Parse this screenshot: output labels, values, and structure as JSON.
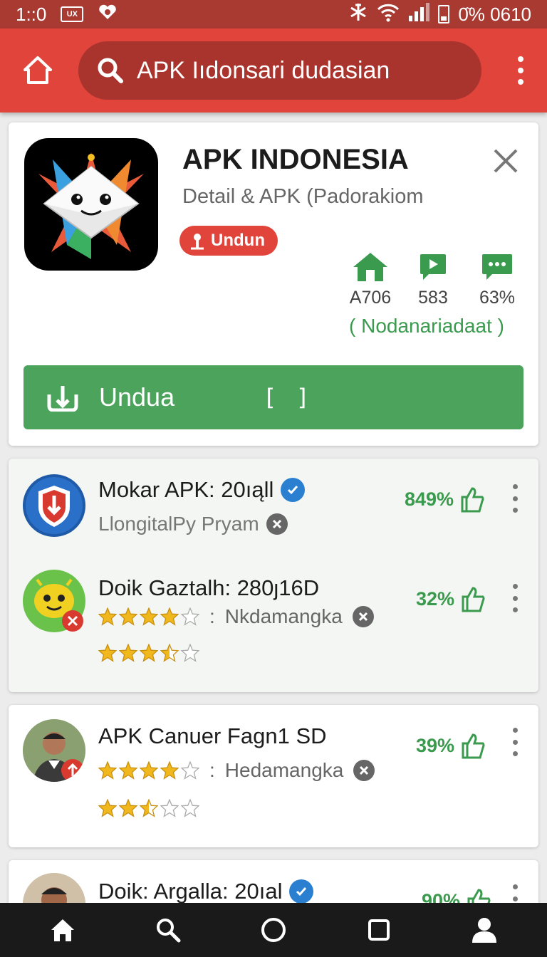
{
  "status_bar": {
    "time": "1::0",
    "box_label": "UX",
    "right_text": "0᷉% 0610",
    "battery_level": 0.3
  },
  "app_bar": {
    "search_text": "APK Iıdonsari dudasian"
  },
  "detail": {
    "title": "APK INDONESIA",
    "subtitle": "Detail & APK (Padorakiom",
    "badge_label": "Undun",
    "stats": [
      {
        "icon": "house-icon",
        "value": "A706"
      },
      {
        "icon": "play-icon",
        "value": "583"
      },
      {
        "icon": "chat-icon",
        "value": "63%"
      }
    ],
    "stats_note": "( Nodanariadaat )",
    "download_label": "Undua",
    "download_bracket": "[ ]"
  },
  "list": [
    {
      "title": "Mokar APK: 20ıąll",
      "subtitle": "LlongitalPy Pryam",
      "percent": "849%",
      "rating": 0,
      "verified": true
    },
    {
      "title": "Doik Gaztalh: 280ȷ16D",
      "rating_text": "Nkdamangka",
      "percent": "32%",
      "rating": 4,
      "second_rating": 3.5
    },
    {
      "title": "APK Canuer Fagn1 SD",
      "rating_text": "Hedamangka",
      "percent": "39%",
      "rating": 4,
      "second_rating": 2.5
    },
    {
      "title": "Doik: Argalla: 20ıal",
      "percent": "90%",
      "verified": true
    }
  ],
  "colors": {
    "status_bar": "#a93a32",
    "app_bar": "#e0443a",
    "search_bg": "#a9332d",
    "accent_green": "#4ca45c",
    "percent_green": "#3a9a4d",
    "star": "#f0b81c"
  },
  "nav": [
    "home-icon",
    "search-icon",
    "circle-home-icon",
    "square-recents-icon",
    "person-icon"
  ]
}
